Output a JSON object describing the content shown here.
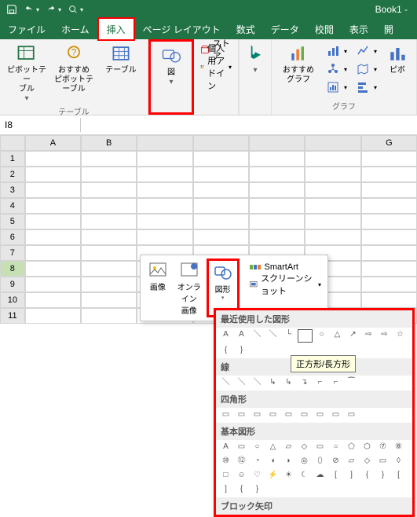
{
  "titlebar": {
    "book": "Book1 -"
  },
  "tabs": {
    "file": "ファイル",
    "home": "ホーム",
    "insert": "挿入",
    "pagelayout": "ページ レイアウト",
    "formulas": "数式",
    "data": "データ",
    "review": "校閲",
    "view": "表示",
    "dev": "開"
  },
  "ribbon": {
    "pivot": "ピボットテー\nブル",
    "recpivot": "おすすめ\nピボットテーブル",
    "table": "テーブル",
    "tables_label": "テーブル",
    "illust": "図",
    "store": "ストア",
    "myaddins": "個人用アドイン",
    "recchart": "おすすめ\nグラフ",
    "pivotch": "ピボ",
    "charts_label": "グラフ"
  },
  "namebox": "I8",
  "cols": [
    "A",
    "B",
    "",
    "",
    "",
    "",
    "G"
  ],
  "rows": [
    "1",
    "2",
    "3",
    "4",
    "5",
    "6",
    "7",
    "8",
    "9",
    "10",
    "11"
  ],
  "illus_pop": {
    "pic": "画像",
    "online": "オンライン\n画像",
    "shapes": "図形",
    "smartart": "SmartArt",
    "screenshot": "スクリーンショット"
  },
  "shape_pop": {
    "recent": "最近使用した図形",
    "lines": "線",
    "rects": "四角形",
    "basic": "基本図形",
    "block": "ブロック矢印"
  },
  "tooltip": "正方形/長方形"
}
